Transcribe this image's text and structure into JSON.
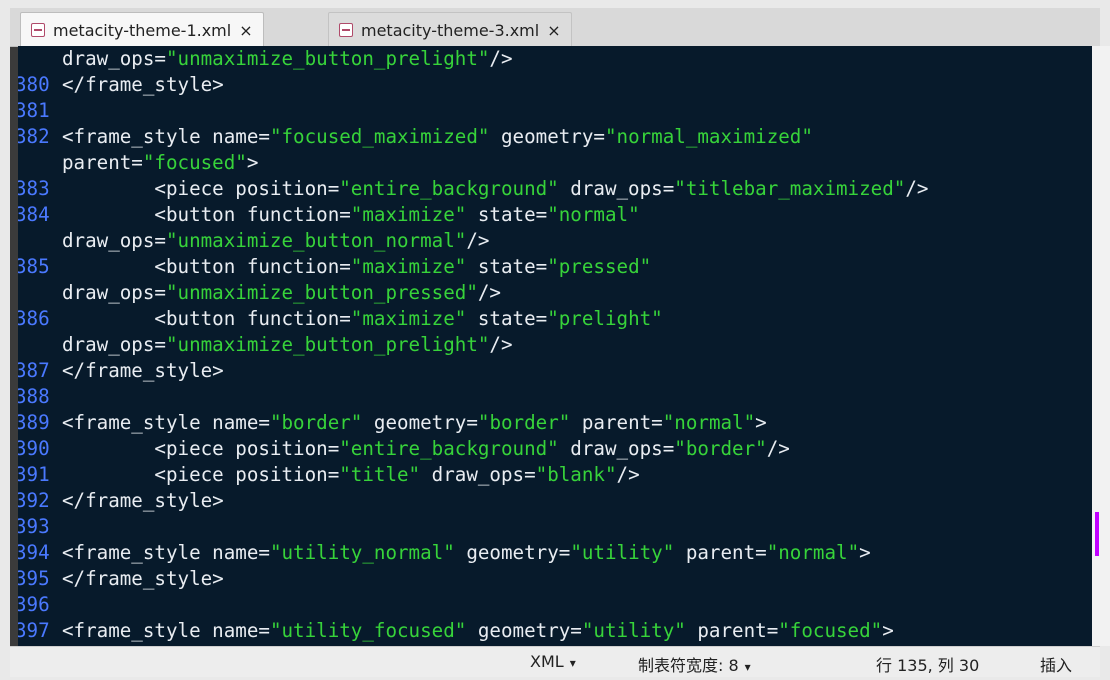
{
  "tabs": [
    {
      "label": "metacity-theme-1.xml",
      "close": "×",
      "active": true
    },
    {
      "label": "metacity-theme-3.xml",
      "close": "×",
      "active": false
    }
  ],
  "editor": {
    "lines": [
      {
        "ln": "",
        "code": [
          {
            "t": "draw_ops="
          },
          {
            "t": "\"unmaximize_button_prelight\"",
            "s": true
          },
          {
            "t": "/>"
          }
        ]
      },
      {
        "ln": "380",
        "code": [
          {
            "t": "</frame_style>"
          }
        ]
      },
      {
        "ln": "381",
        "code": []
      },
      {
        "ln": "382",
        "code": [
          {
            "t": "<frame_style name="
          },
          {
            "t": "\"focused_maximized\"",
            "s": true
          },
          {
            "t": " geometry="
          },
          {
            "t": "\"normal_maximized\"",
            "s": true
          }
        ]
      },
      {
        "ln": "",
        "code": [
          {
            "t": "parent="
          },
          {
            "t": "\"focused\"",
            "s": true
          },
          {
            "t": ">"
          }
        ]
      },
      {
        "ln": "383",
        "code": [
          {
            "t": "        <piece position="
          },
          {
            "t": "\"entire_background\"",
            "s": true
          },
          {
            "t": " draw_ops="
          },
          {
            "t": "\"titlebar_maximized\"",
            "s": true
          },
          {
            "t": "/>"
          }
        ]
      },
      {
        "ln": "384",
        "code": [
          {
            "t": "        <button function="
          },
          {
            "t": "\"maximize\"",
            "s": true
          },
          {
            "t": " state="
          },
          {
            "t": "\"normal\"",
            "s": true
          }
        ]
      },
      {
        "ln": "",
        "code": [
          {
            "t": "draw_ops="
          },
          {
            "t": "\"unmaximize_button_normal\"",
            "s": true
          },
          {
            "t": "/>"
          }
        ]
      },
      {
        "ln": "385",
        "code": [
          {
            "t": "        <button function="
          },
          {
            "t": "\"maximize\"",
            "s": true
          },
          {
            "t": " state="
          },
          {
            "t": "\"pressed\"",
            "s": true
          }
        ]
      },
      {
        "ln": "",
        "code": [
          {
            "t": "draw_ops="
          },
          {
            "t": "\"unmaximize_button_pressed\"",
            "s": true
          },
          {
            "t": "/>"
          }
        ]
      },
      {
        "ln": "386",
        "code": [
          {
            "t": "        <button function="
          },
          {
            "t": "\"maximize\"",
            "s": true
          },
          {
            "t": " state="
          },
          {
            "t": "\"prelight\"",
            "s": true
          }
        ]
      },
      {
        "ln": "",
        "code": [
          {
            "t": "draw_ops="
          },
          {
            "t": "\"unmaximize_button_prelight\"",
            "s": true
          },
          {
            "t": "/>"
          }
        ]
      },
      {
        "ln": "387",
        "code": [
          {
            "t": "</frame_style>"
          }
        ]
      },
      {
        "ln": "388",
        "code": []
      },
      {
        "ln": "389",
        "code": [
          {
            "t": "<frame_style name="
          },
          {
            "t": "\"border\"",
            "s": true
          },
          {
            "t": " geometry="
          },
          {
            "t": "\"border\"",
            "s": true
          },
          {
            "t": " parent="
          },
          {
            "t": "\"normal\"",
            "s": true
          },
          {
            "t": ">"
          }
        ]
      },
      {
        "ln": "390",
        "code": [
          {
            "t": "        <piece position="
          },
          {
            "t": "\"entire_background\"",
            "s": true
          },
          {
            "t": " draw_ops="
          },
          {
            "t": "\"border\"",
            "s": true
          },
          {
            "t": "/>"
          }
        ]
      },
      {
        "ln": "391",
        "code": [
          {
            "t": "        <piece position="
          },
          {
            "t": "\"title\"",
            "s": true
          },
          {
            "t": " draw_ops="
          },
          {
            "t": "\"blank\"",
            "s": true
          },
          {
            "t": "/>"
          }
        ]
      },
      {
        "ln": "392",
        "code": [
          {
            "t": "</frame_style>"
          }
        ]
      },
      {
        "ln": "393",
        "code": []
      },
      {
        "ln": "394",
        "code": [
          {
            "t": "<frame_style name="
          },
          {
            "t": "\"utility_normal\"",
            "s": true
          },
          {
            "t": " geometry="
          },
          {
            "t": "\"utility\"",
            "s": true
          },
          {
            "t": " parent="
          },
          {
            "t": "\"normal\"",
            "s": true
          },
          {
            "t": ">"
          }
        ]
      },
      {
        "ln": "395",
        "code": [
          {
            "t": "</frame_style>"
          }
        ]
      },
      {
        "ln": "396",
        "code": []
      },
      {
        "ln": "397",
        "code": [
          {
            "t": "<frame_style name="
          },
          {
            "t": "\"utility_focused\"",
            "s": true
          },
          {
            "t": " geometry="
          },
          {
            "t": "\"utility\"",
            "s": true
          },
          {
            "t": " parent="
          },
          {
            "t": "\"focused\"",
            "s": true
          },
          {
            "t": ">"
          }
        ]
      }
    ]
  },
  "status": {
    "language": "XML",
    "tab_width": "制表符宽度: 8",
    "position": "行 135, 列 30",
    "mode": "插入",
    "dropdown_glyph": "▾"
  },
  "colors": {
    "editor_bg": "#071a2b",
    "line_number": "#4a79ff",
    "string": "#37d33a",
    "text": "#e9edf2"
  }
}
